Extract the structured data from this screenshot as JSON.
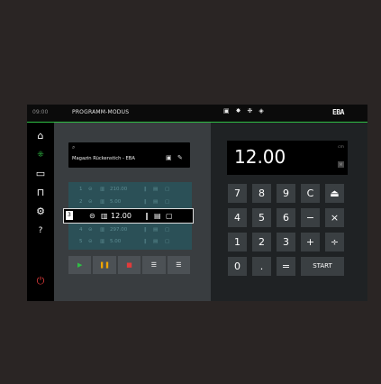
{
  "topbar": {
    "time": "09:00",
    "mode_title": "PROGRAMM-MODUS",
    "status_icons": [
      "bin-icon",
      "sun-icon",
      "gear-dot-icon",
      "speaker-icon"
    ],
    "logo": "EBA",
    "accent_color": "#2fbf45"
  },
  "sidebar": {
    "items": [
      {
        "name": "home-icon",
        "glyph": "⌂"
      },
      {
        "name": "move-icon",
        "glyph": "⁘"
      },
      {
        "name": "folder-icon",
        "glyph": "▭"
      },
      {
        "name": "blade-icon",
        "glyph": "⊓"
      },
      {
        "name": "settings-icon",
        "glyph": "⚙"
      },
      {
        "name": "help-icon",
        "glyph": "?"
      },
      {
        "name": "power-icon",
        "glyph": "⏻"
      }
    ]
  },
  "magazine": {
    "search_icon": "search-icon",
    "title": "Magazin Rückenstich - EBA"
  },
  "cuts": [
    {
      "num": "1",
      "value": "210.00"
    },
    {
      "num": "2",
      "value": "5.00"
    },
    {
      "num": "3",
      "value": "12.00"
    },
    {
      "num": "4",
      "value": "297.00"
    },
    {
      "num": "5",
      "value": "5.00"
    }
  ],
  "selected_index": 2,
  "controls": [
    {
      "name": "play-button",
      "glyph": "▶",
      "color": "#2fbf45"
    },
    {
      "name": "pause-button",
      "glyph": "❚❚",
      "color": "#f0a500"
    },
    {
      "name": "stop-button",
      "glyph": "■",
      "color": "#e23b3b"
    },
    {
      "name": "list-button",
      "glyph": "☰",
      "color": "#ffffff"
    },
    {
      "name": "list-indent-button",
      "glyph": "☰",
      "color": "#ffffff"
    }
  ],
  "display": {
    "value": "12.00",
    "unit": "cm",
    "lock": "M"
  },
  "keypad": [
    [
      "7",
      "8",
      "9",
      "C",
      "⏏"
    ],
    [
      "4",
      "5",
      "6",
      "−",
      "×"
    ],
    [
      "1",
      "2",
      "3",
      "+",
      "÷"
    ],
    [
      "0",
      ".",
      "=",
      "START"
    ]
  ]
}
